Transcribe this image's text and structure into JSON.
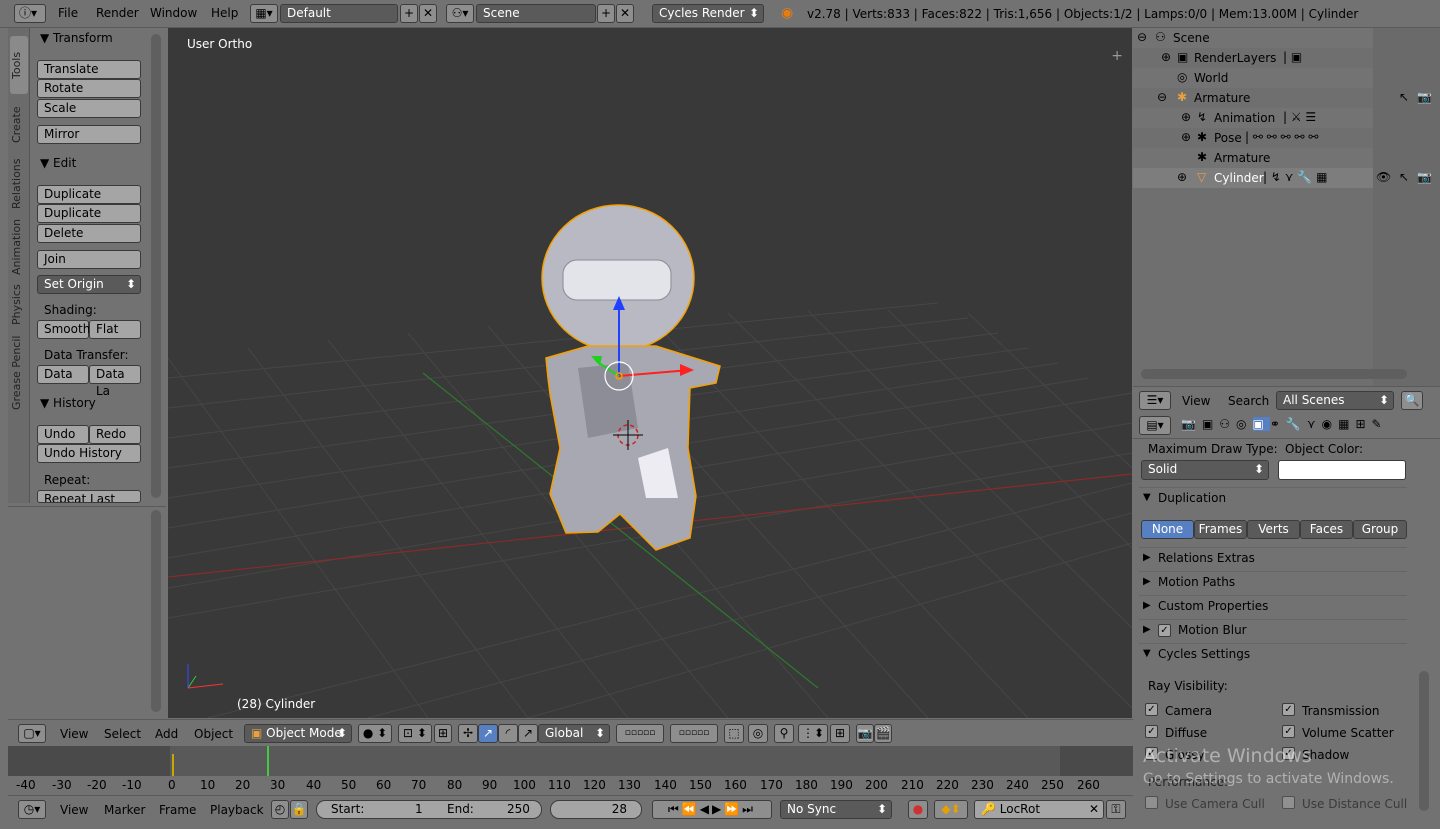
{
  "topbar": {
    "menus": [
      "File",
      "Render",
      "Window",
      "Help"
    ],
    "layout": "Default",
    "scene": "Scene",
    "engine": "Cycles Render",
    "stats": "v2.78 | Verts:833 | Faces:822 | Tris:1,656 | Objects:1/2 | Lamps:0/0 | Mem:13.00M | Cylinder"
  },
  "tabs": [
    "Tools",
    "Create",
    "Relations",
    "Animation",
    "Physics",
    "Grease Pencil"
  ],
  "tools": {
    "transform": {
      "title": "Transform",
      "buttons": [
        "Translate",
        "Rotate",
        "Scale",
        "Mirror"
      ]
    },
    "edit": {
      "title": "Edit",
      "buttons": [
        "Duplicate",
        "Duplicate Linked",
        "Delete",
        "Join"
      ],
      "set_origin": "Set Origin",
      "shading_label": "Shading:",
      "smooth": "Smooth",
      "flat": "Flat",
      "data_transfer_label": "Data Transfer:",
      "data": "Data",
      "data_la": "Data La"
    },
    "history": {
      "title": "History",
      "undo": "Undo",
      "redo": "Redo",
      "undo_history": "Undo History",
      "repeat_label": "Repeat:",
      "repeat_last": "Repeat Last"
    }
  },
  "viewport": {
    "view_label": "User Ortho",
    "object_label": "(28) Cylinder"
  },
  "outliner": {
    "rows": [
      "Scene",
      "RenderLayers",
      "World",
      "Armature",
      "Animation",
      "Pose",
      "Armature",
      "Cylinder"
    ],
    "view": "View",
    "search": "Search",
    "filter": "All Scenes"
  },
  "properties": {
    "max_draw_type_label": "Maximum Draw Type:",
    "max_draw_type": "Solid",
    "object_color_label": "Object Color:",
    "duplication": "Duplication",
    "dup_options": [
      "None",
      "Frames",
      "Verts",
      "Faces",
      "Group"
    ],
    "sections": [
      "Relations Extras",
      "Motion Paths",
      "Custom Properties",
      "Motion Blur",
      "Cycles Settings"
    ],
    "ray_visibility_label": "Ray Visibility:",
    "rays": [
      {
        "label": "Camera",
        "on": true
      },
      {
        "label": "Transmission",
        "on": true
      },
      {
        "label": "Diffuse",
        "on": true
      },
      {
        "label": "Volume Scatter",
        "on": true
      },
      {
        "label": "Glossy",
        "on": true
      },
      {
        "label": "Shadow",
        "on": true
      }
    ],
    "performance_label": "Performance:",
    "use_camera_cull": "Use Camera Cull",
    "use_distance_cull": "Use Distance Cull",
    "watermark_title": "Activate Windows",
    "watermark_sub": "Go to Settings to activate Windows."
  },
  "viewport_header": {
    "view": "View",
    "select": "Select",
    "add": "Add",
    "object": "Object",
    "mode": "Object Mode",
    "orientation": "Global"
  },
  "timeline": {
    "ticks": [
      "-40",
      "-30",
      "-20",
      "-10",
      "0",
      "10",
      "20",
      "30",
      "40",
      "50",
      "60",
      "70",
      "80",
      "90",
      "100",
      "110",
      "120",
      "130",
      "140",
      "150",
      "160",
      "170",
      "180",
      "190",
      "200",
      "210",
      "220",
      "230",
      "240",
      "250",
      "260"
    ]
  },
  "timeline_header": {
    "view": "View",
    "marker": "Marker",
    "frame": "Frame",
    "playback": "Playback",
    "start_label": "Start:",
    "start": "1",
    "end_label": "End:",
    "end": "250",
    "current": "28",
    "sync": "No Sync",
    "keying_set": "LocRot"
  },
  "colors": {
    "accent": "#5680c2",
    "viewport_bg": "#393939",
    "panel_bg": "#727272",
    "selection_outline": "#f5a000"
  }
}
